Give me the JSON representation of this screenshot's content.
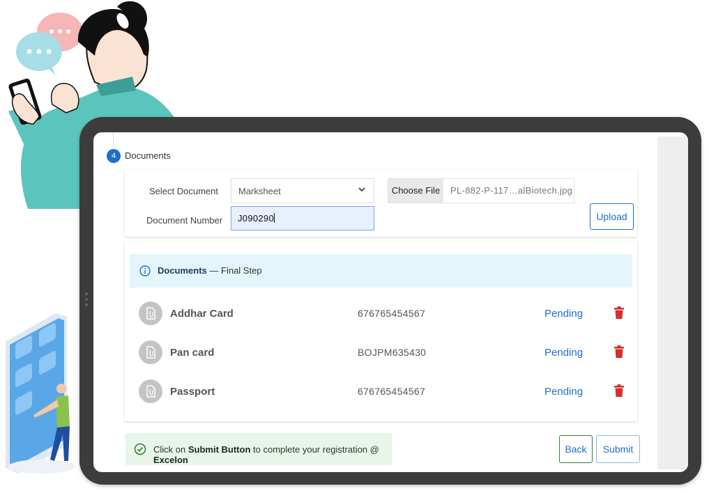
{
  "step": {
    "number": "4",
    "title": "Documents"
  },
  "form": {
    "select_label": "Select Document",
    "select_value": "Marksheet",
    "number_label": "Document Number",
    "number_value": "J090290",
    "choose_file_label": "Choose File",
    "file_name": "PL-882-P-117…alBiotech.jpg",
    "upload_label": "Upload"
  },
  "info": {
    "title": "Documents",
    "subtitle": " — Final Step"
  },
  "documents": [
    {
      "name": "Addhar Card",
      "number": "676765454567",
      "status": "Pending"
    },
    {
      "name": "Pan card",
      "number": "BOJPM635430",
      "status": "Pending"
    },
    {
      "name": "Passport",
      "number": "676765454567",
      "status": "Pending"
    }
  ],
  "footer": {
    "alert_pre": "Click on ",
    "alert_bold1": "Submit Button",
    "alert_mid": " to complete your registration @ ",
    "alert_bold2": "Excelon",
    "back_label": "Back",
    "submit_label": "Submit"
  },
  "colors": {
    "accent": "#1e6fc9",
    "delete": "#d32f2f",
    "info_bg": "#e4f5fc",
    "success_bg": "#e8f5e9",
    "success_icon": "#2e7d32"
  },
  "icons": {
    "select": "chevron-down-icon",
    "info": "info-circle-icon",
    "document": "file-icon",
    "delete": "trash-icon",
    "alert": "check-circle-icon"
  }
}
